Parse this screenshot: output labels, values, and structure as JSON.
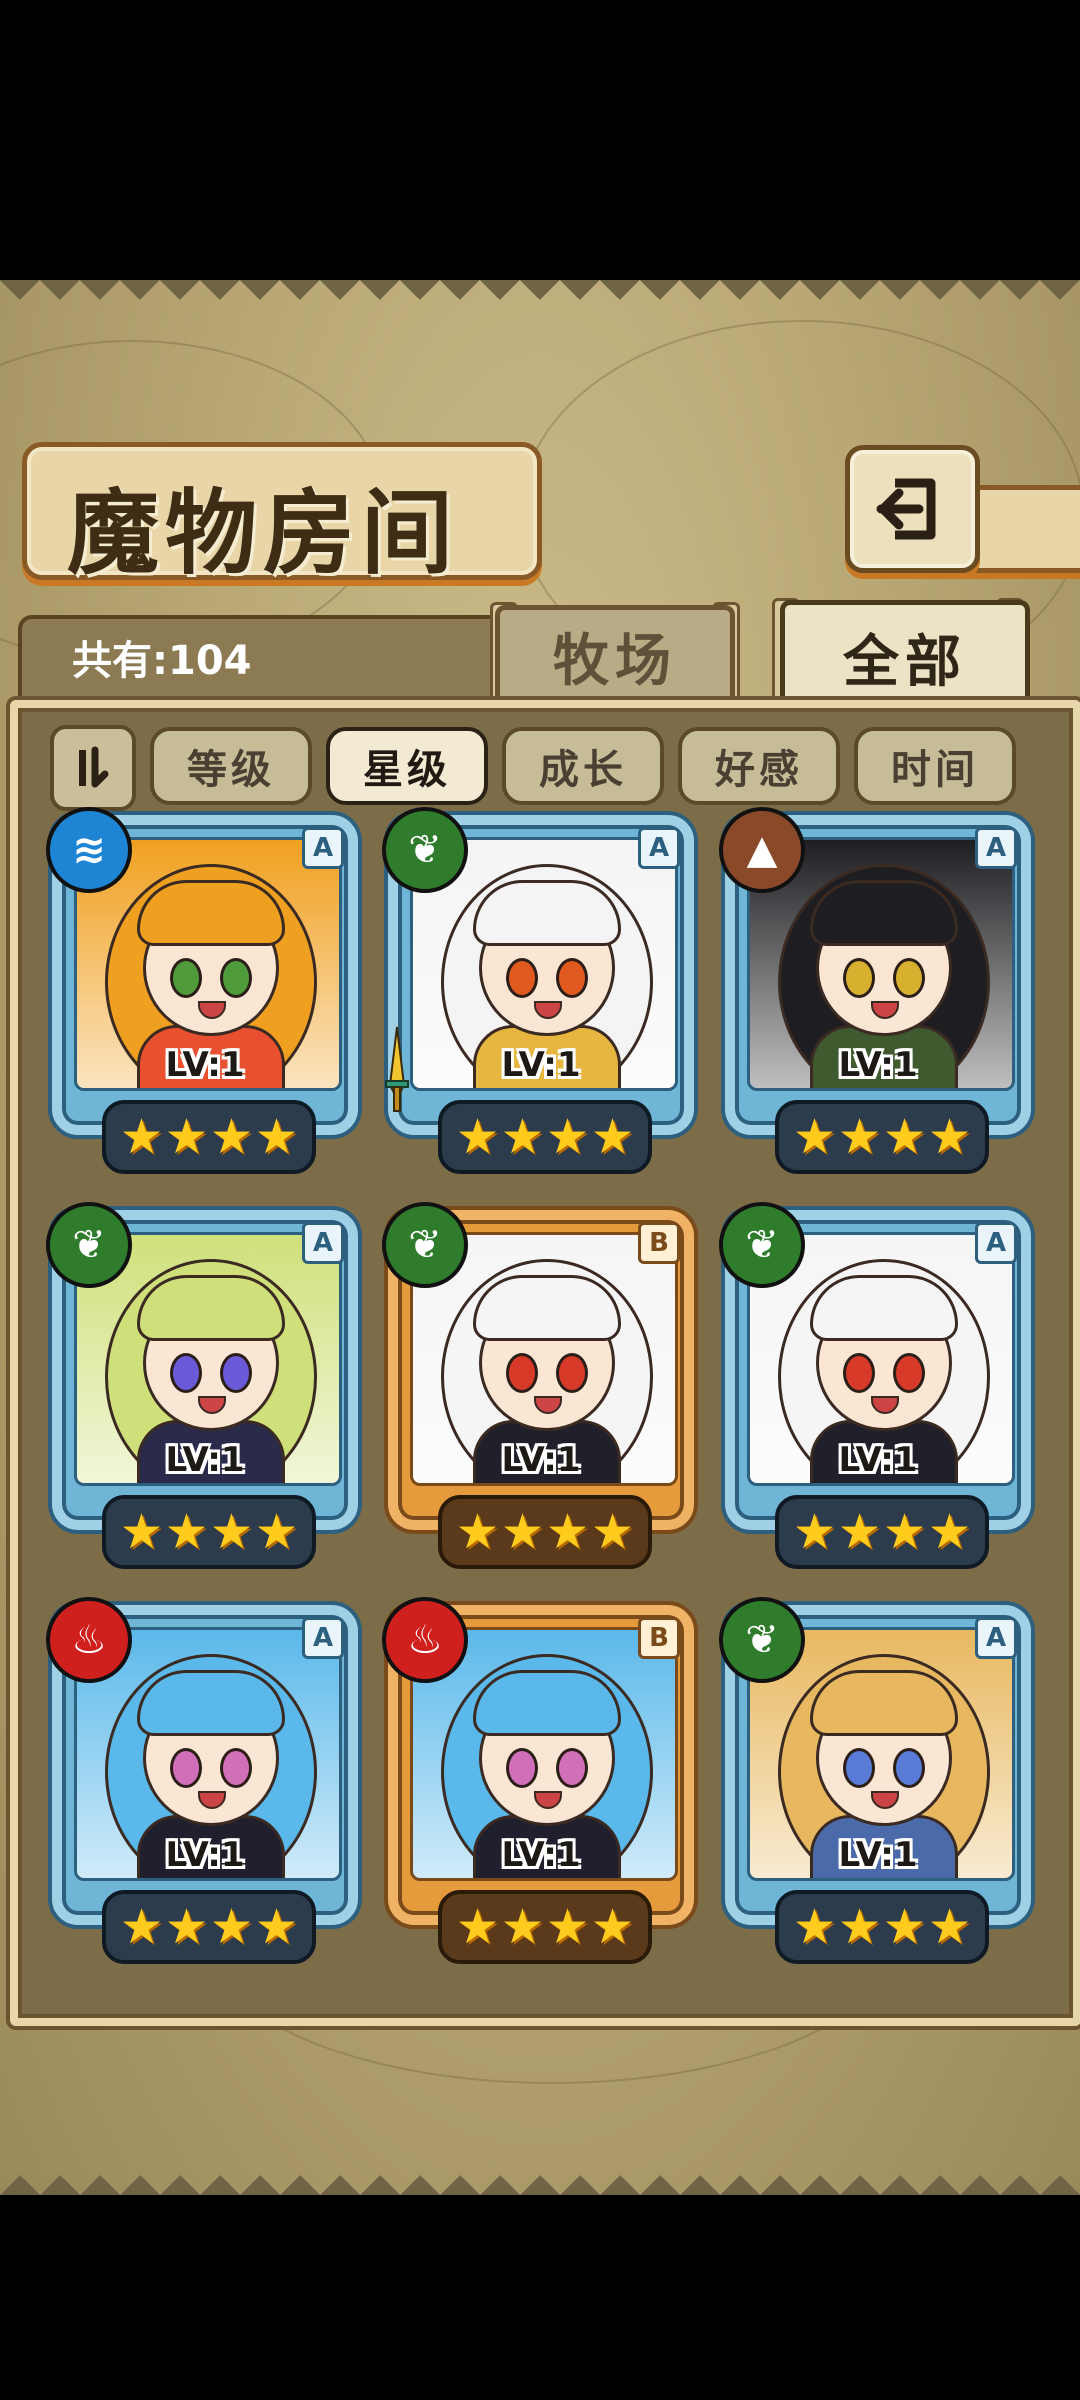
{
  "header": {
    "title": "魔物房间"
  },
  "summary": {
    "count_text": "共有:104"
  },
  "tabs": [
    {
      "label": "牧场",
      "active": false
    },
    {
      "label": "全部",
      "active": true
    }
  ],
  "filters": {
    "sort_toggle_label": "⇂",
    "options": [
      "等级",
      "星级",
      "成长",
      "好感",
      "时间"
    ],
    "selected": "星级"
  },
  "colors": {
    "frame_blue": "#9fd0e6",
    "frame_gold": "#f0b264",
    "star": "#ffcc1e",
    "element_water": "#1e84d4",
    "element_grass": "#2f7d2c",
    "element_earth": "#8a4a2a",
    "element_fire": "#d0201e"
  },
  "cards": [
    {
      "level": "LV:1",
      "rank": "A",
      "frame": "blue",
      "element": "water",
      "element_icon": "water-wave-icon",
      "stars": 4,
      "hair": "#f0a020",
      "eyes": "#4f9a3a",
      "outfit": "#e85030"
    },
    {
      "level": "LV:1",
      "rank": "A",
      "frame": "blue",
      "element": "grass",
      "element_icon": "leaf-icon",
      "stars": 4,
      "hair": "#f4f4f4",
      "eyes": "#e05a20",
      "outfit": "#e7b640",
      "has_sword": true
    },
    {
      "level": "LV:1",
      "rank": "A",
      "frame": "blue",
      "element": "earth",
      "element_icon": "mountain-icon",
      "stars": 4,
      "hair": "#1e1e22",
      "eyes": "#d8b030",
      "outfit": "#3e5a2e"
    },
    {
      "level": "LV:1",
      "rank": "A",
      "frame": "blue",
      "element": "grass",
      "element_icon": "leaf-icon",
      "stars": 4,
      "hair": "#cfe07a",
      "eyes": "#6a5ad8",
      "outfit": "#2a2a4a"
    },
    {
      "level": "LV:1",
      "rank": "B",
      "frame": "gold",
      "element": "grass",
      "element_icon": "leaf-icon",
      "stars": 4,
      "hair": "#f5f5f5",
      "eyes": "#d83a2a",
      "outfit": "#20202a"
    },
    {
      "level": "LV:1",
      "rank": "A",
      "frame": "blue",
      "element": "grass",
      "element_icon": "leaf-icon",
      "stars": 4,
      "hair": "#f5f5f5",
      "eyes": "#d83a2a",
      "outfit": "#20202a"
    },
    {
      "level": "LV:1",
      "rank": "A",
      "frame": "blue",
      "element": "fire",
      "element_icon": "flame-icon",
      "stars": 4,
      "hair": "#5ab8ea",
      "eyes": "#d070b8",
      "outfit": "#1f1f2e"
    },
    {
      "level": "LV:1",
      "rank": "B",
      "frame": "gold",
      "element": "fire",
      "element_icon": "flame-icon",
      "stars": 4,
      "hair": "#5ab8ea",
      "eyes": "#d070b8",
      "outfit": "#1f1f2e"
    },
    {
      "level": "LV:1",
      "rank": "A",
      "frame": "blue",
      "element": "grass",
      "element_icon": "leaf-icon",
      "stars": 4,
      "hair": "#e8b860",
      "eyes": "#5a7ad8",
      "outfit": "#4a6aaa"
    }
  ]
}
